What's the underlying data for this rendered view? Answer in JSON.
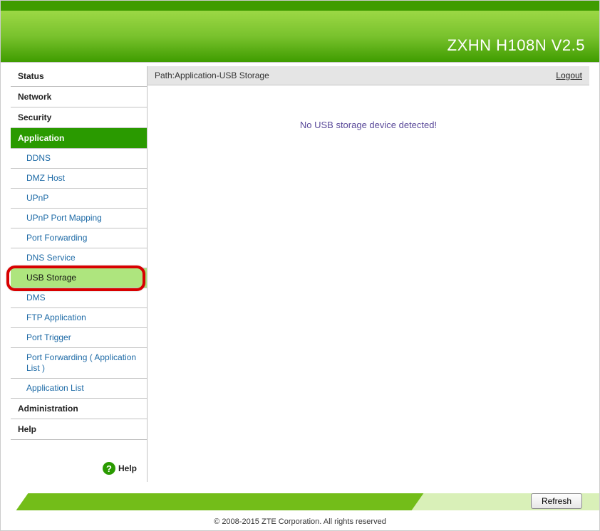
{
  "header": {
    "title": "ZXHN H108N V2.5"
  },
  "sidebar": {
    "top": [
      {
        "label": "Status",
        "active": false
      },
      {
        "label": "Network",
        "active": false
      },
      {
        "label": "Security",
        "active": false
      },
      {
        "label": "Application",
        "active": true
      }
    ],
    "subs": [
      {
        "label": "DDNS"
      },
      {
        "label": "DMZ Host"
      },
      {
        "label": "UPnP"
      },
      {
        "label": "UPnP Port Mapping"
      },
      {
        "label": "Port Forwarding"
      },
      {
        "label": "DNS Service"
      },
      {
        "label": "USB Storage",
        "selected": true,
        "highlighted": true
      },
      {
        "label": "DMS"
      },
      {
        "label": "FTP Application"
      },
      {
        "label": "Port Trigger"
      },
      {
        "label": "Port Forwarding ( Application List )"
      },
      {
        "label": "Application List"
      }
    ],
    "bottom": [
      {
        "label": "Administration"
      },
      {
        "label": "Help"
      }
    ],
    "help_label": "Help",
    "help_glyph": "?"
  },
  "path": "Path:Application-USB Storage",
  "logout": "Logout",
  "status_message": "No USB storage device detected!",
  "refresh_label": "Refresh",
  "copyright": "© 2008-2015 ZTE Corporation. All rights reserved"
}
